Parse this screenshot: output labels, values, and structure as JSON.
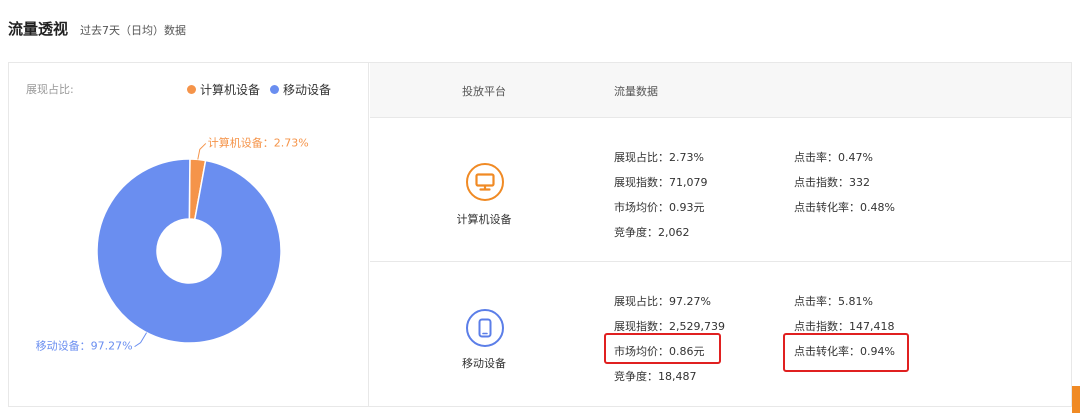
{
  "header": {
    "title": "流量透视",
    "subtitle": "过去7天（日均）数据"
  },
  "chart": {
    "share_label": "展现占比:",
    "legend": [
      {
        "name": "计算机设备",
        "color": "#f5944a"
      },
      {
        "name": "移动设备",
        "color": "#6a8ef0"
      }
    ],
    "labels": {
      "desktop": "计算机设备：2.73%",
      "mobile": "移动设备：97.27%"
    }
  },
  "chart_data": {
    "type": "pie",
    "categories": [
      "计算机设备",
      "移动设备"
    ],
    "values": [
      2.73,
      97.27
    ],
    "colors": [
      "#f5944a",
      "#6a8ef0"
    ],
    "title": "",
    "legend_position": "top-right"
  },
  "table": {
    "headers": {
      "platform": "投放平台",
      "data": "流量数据"
    },
    "rows": [
      {
        "platform": "计算机设备",
        "icon": "monitor-icon",
        "color": "#f08a24",
        "impression_share": "展现占比：2.73%",
        "impression_index": "展现指数：71,079",
        "avg_price": "市场均价：0.93元",
        "competition": "竞争度：2,062",
        "ctr": "点击率：0.47%",
        "click_index": "点击指数：332",
        "cvr": "点击转化率：0.48%"
      },
      {
        "platform": "移动设备",
        "icon": "phone-icon",
        "color": "#5b7ee8",
        "impression_share": "展现占比：97.27%",
        "impression_index": "展现指数：2,529,739",
        "avg_price": "市场均价：0.86元",
        "competition": "竞争度：18,487",
        "ctr": "点击率：5.81%",
        "click_index": "点击指数：147,418",
        "cvr": "点击转化率：0.94%"
      }
    ]
  }
}
